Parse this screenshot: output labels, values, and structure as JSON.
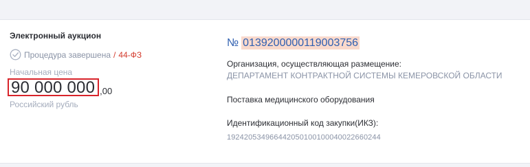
{
  "procurement": {
    "type": "Электронный аукцион",
    "status": "Процедура завершена",
    "status_separator": "/",
    "law": "44-ФЗ",
    "price_label": "Начальная цена",
    "price_main": "90 000 000",
    "price_cents": ",00",
    "currency": "Российский рубль",
    "number_sign": "№",
    "number": "0139200000119003756",
    "org_label": "Организация, осуществляющая размещение:",
    "org_name": "ДЕПАРТАМЕНТ КОНТРАКТНОЙ СИСТЕМЫ КЕМЕРОВСКОЙ ОБЛАСТИ",
    "subject": "Поставка медицинского оборудования",
    "ikz_label": "Идентификационный код закупки(ИКЗ):",
    "ikz_value": "192420534966442050100100040022660244"
  },
  "icons": {
    "status": "check-circle-icon"
  },
  "colors": {
    "link_blue": "#2f5fb0",
    "highlight": "#f9d9cc",
    "law_red": "#d33a2c",
    "price_outline": "#d8232a"
  }
}
